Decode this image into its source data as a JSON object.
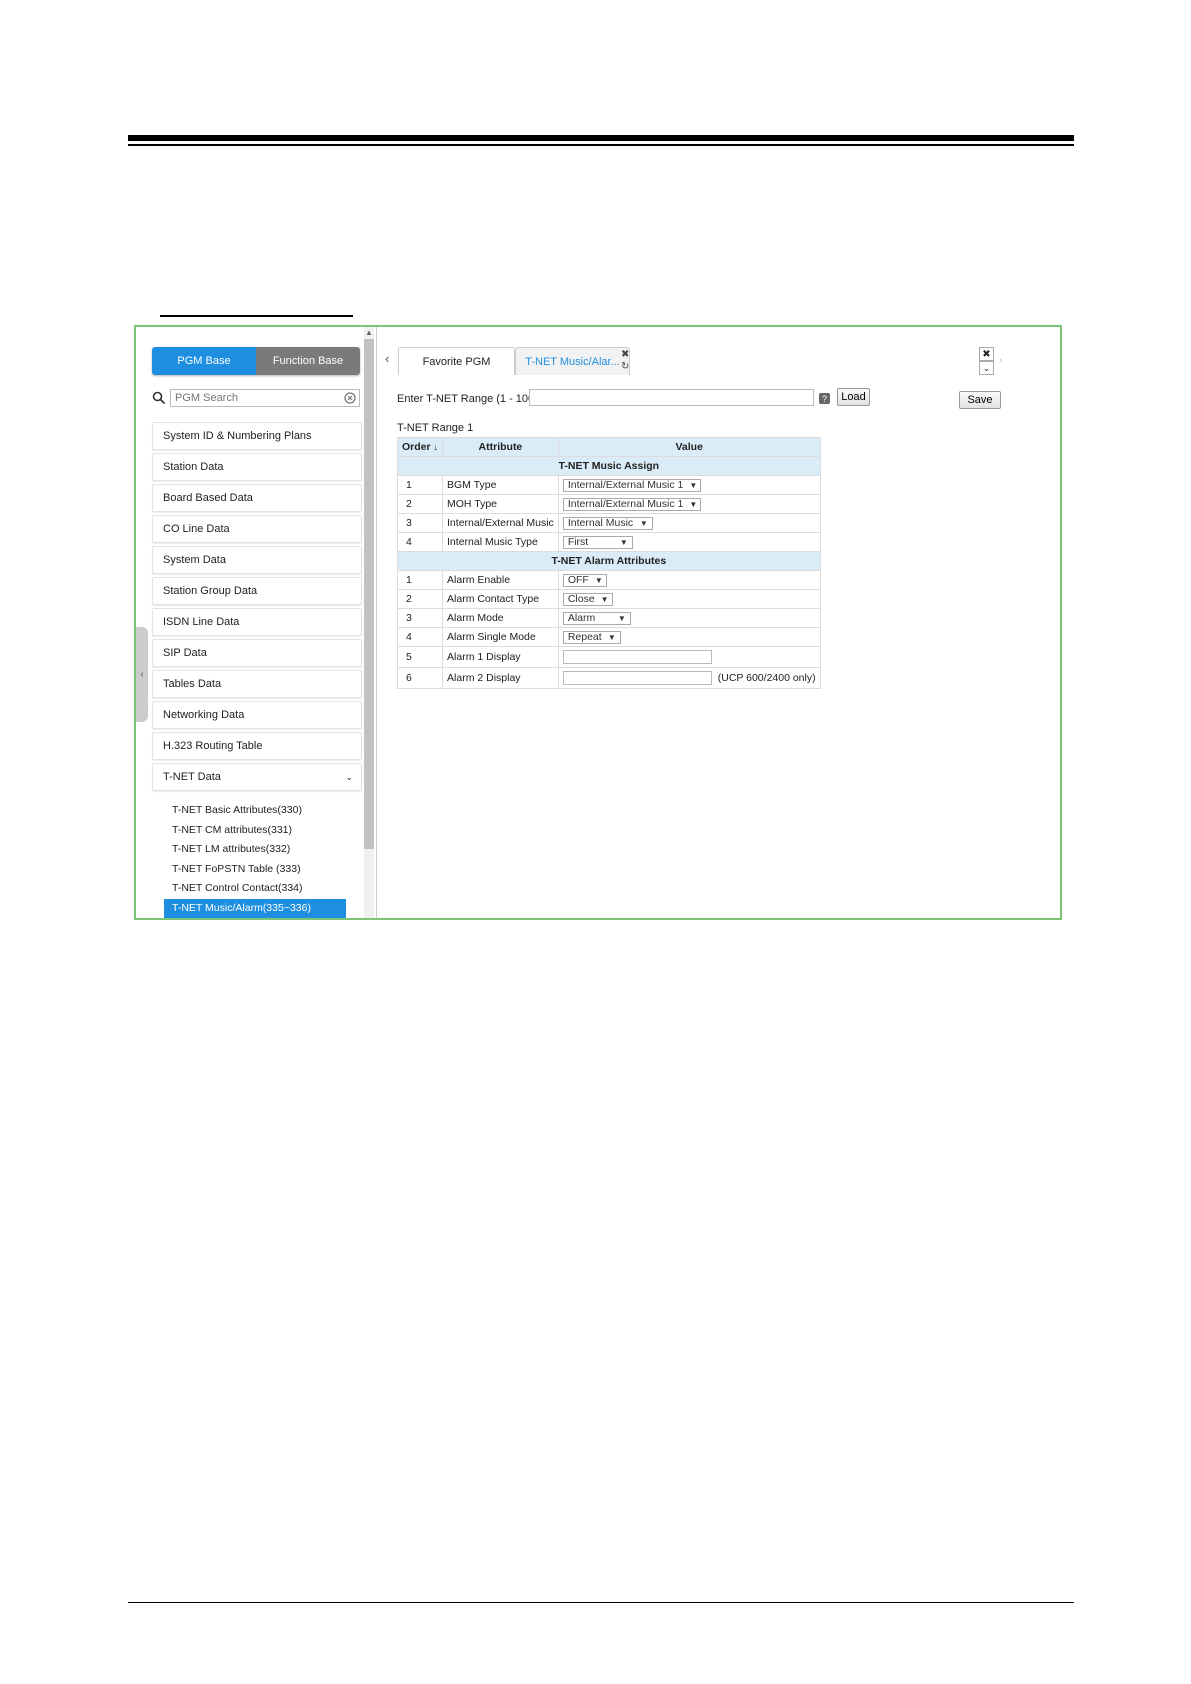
{
  "sidebar": {
    "segment": {
      "pgm_base": "PGM Base",
      "function_base": "Function Base"
    },
    "search": {
      "placeholder": "PGM Search"
    },
    "items": [
      {
        "label": "System ID & Numbering Plans"
      },
      {
        "label": "Station Data"
      },
      {
        "label": "Board Based Data"
      },
      {
        "label": "CO Line Data"
      },
      {
        "label": "System Data"
      },
      {
        "label": "Station Group Data"
      },
      {
        "label": "ISDN Line Data"
      },
      {
        "label": "SIP Data"
      },
      {
        "label": "Tables Data"
      },
      {
        "label": "Networking Data"
      },
      {
        "label": "H.323 Routing Table"
      },
      {
        "label": "T-NET Data"
      }
    ],
    "submenu": [
      {
        "label": "T-NET Basic Attributes(330)"
      },
      {
        "label": "T-NET CM attributes(331)"
      },
      {
        "label": "T-NET LM attributes(332)"
      },
      {
        "label": "T-NET FoPSTN Table (333)"
      },
      {
        "label": "T-NET Control Contact(334)"
      },
      {
        "label": "T-NET Music/Alarm(335~336)"
      }
    ]
  },
  "tabs": {
    "favorite": "Favorite PGM",
    "active": "T-NET Music/Alar..."
  },
  "range": {
    "label": "Enter T-NET Range (1 - 100) :",
    "load": "Load",
    "save": "Save",
    "title": "T-NET Range 1"
  },
  "table": {
    "headers": {
      "order": "Order",
      "attribute": "Attribute",
      "value": "Value"
    },
    "section1": "T-NET Music Assign",
    "music_rows": [
      {
        "order": "1",
        "attribute": "BGM Type",
        "value": "Internal/External Music 1"
      },
      {
        "order": "2",
        "attribute": "MOH Type",
        "value": "Internal/External Music 1"
      },
      {
        "order": "3",
        "attribute": "Internal/External Music",
        "value": "Internal Music"
      },
      {
        "order": "4",
        "attribute": "Internal Music Type",
        "value": "First"
      }
    ],
    "section2": "T-NET Alarm Attributes",
    "alarm_rows": [
      {
        "order": "1",
        "attribute": "Alarm Enable",
        "value": "OFF"
      },
      {
        "order": "2",
        "attribute": "Alarm Contact Type",
        "value": "Close"
      },
      {
        "order": "3",
        "attribute": "Alarm Mode",
        "value": "Alarm"
      },
      {
        "order": "4",
        "attribute": "Alarm Single Mode",
        "value": "Repeat"
      },
      {
        "order": "5",
        "attribute": "Alarm 1 Display",
        "value": ""
      },
      {
        "order": "6",
        "attribute": "Alarm 2 Display",
        "value": "",
        "note": "(UCP 600/2400 only)"
      }
    ]
  },
  "colors": {
    "accent": "#1e8fe0",
    "frame": "#7cc576",
    "header_bg": "#d9ecf7"
  }
}
